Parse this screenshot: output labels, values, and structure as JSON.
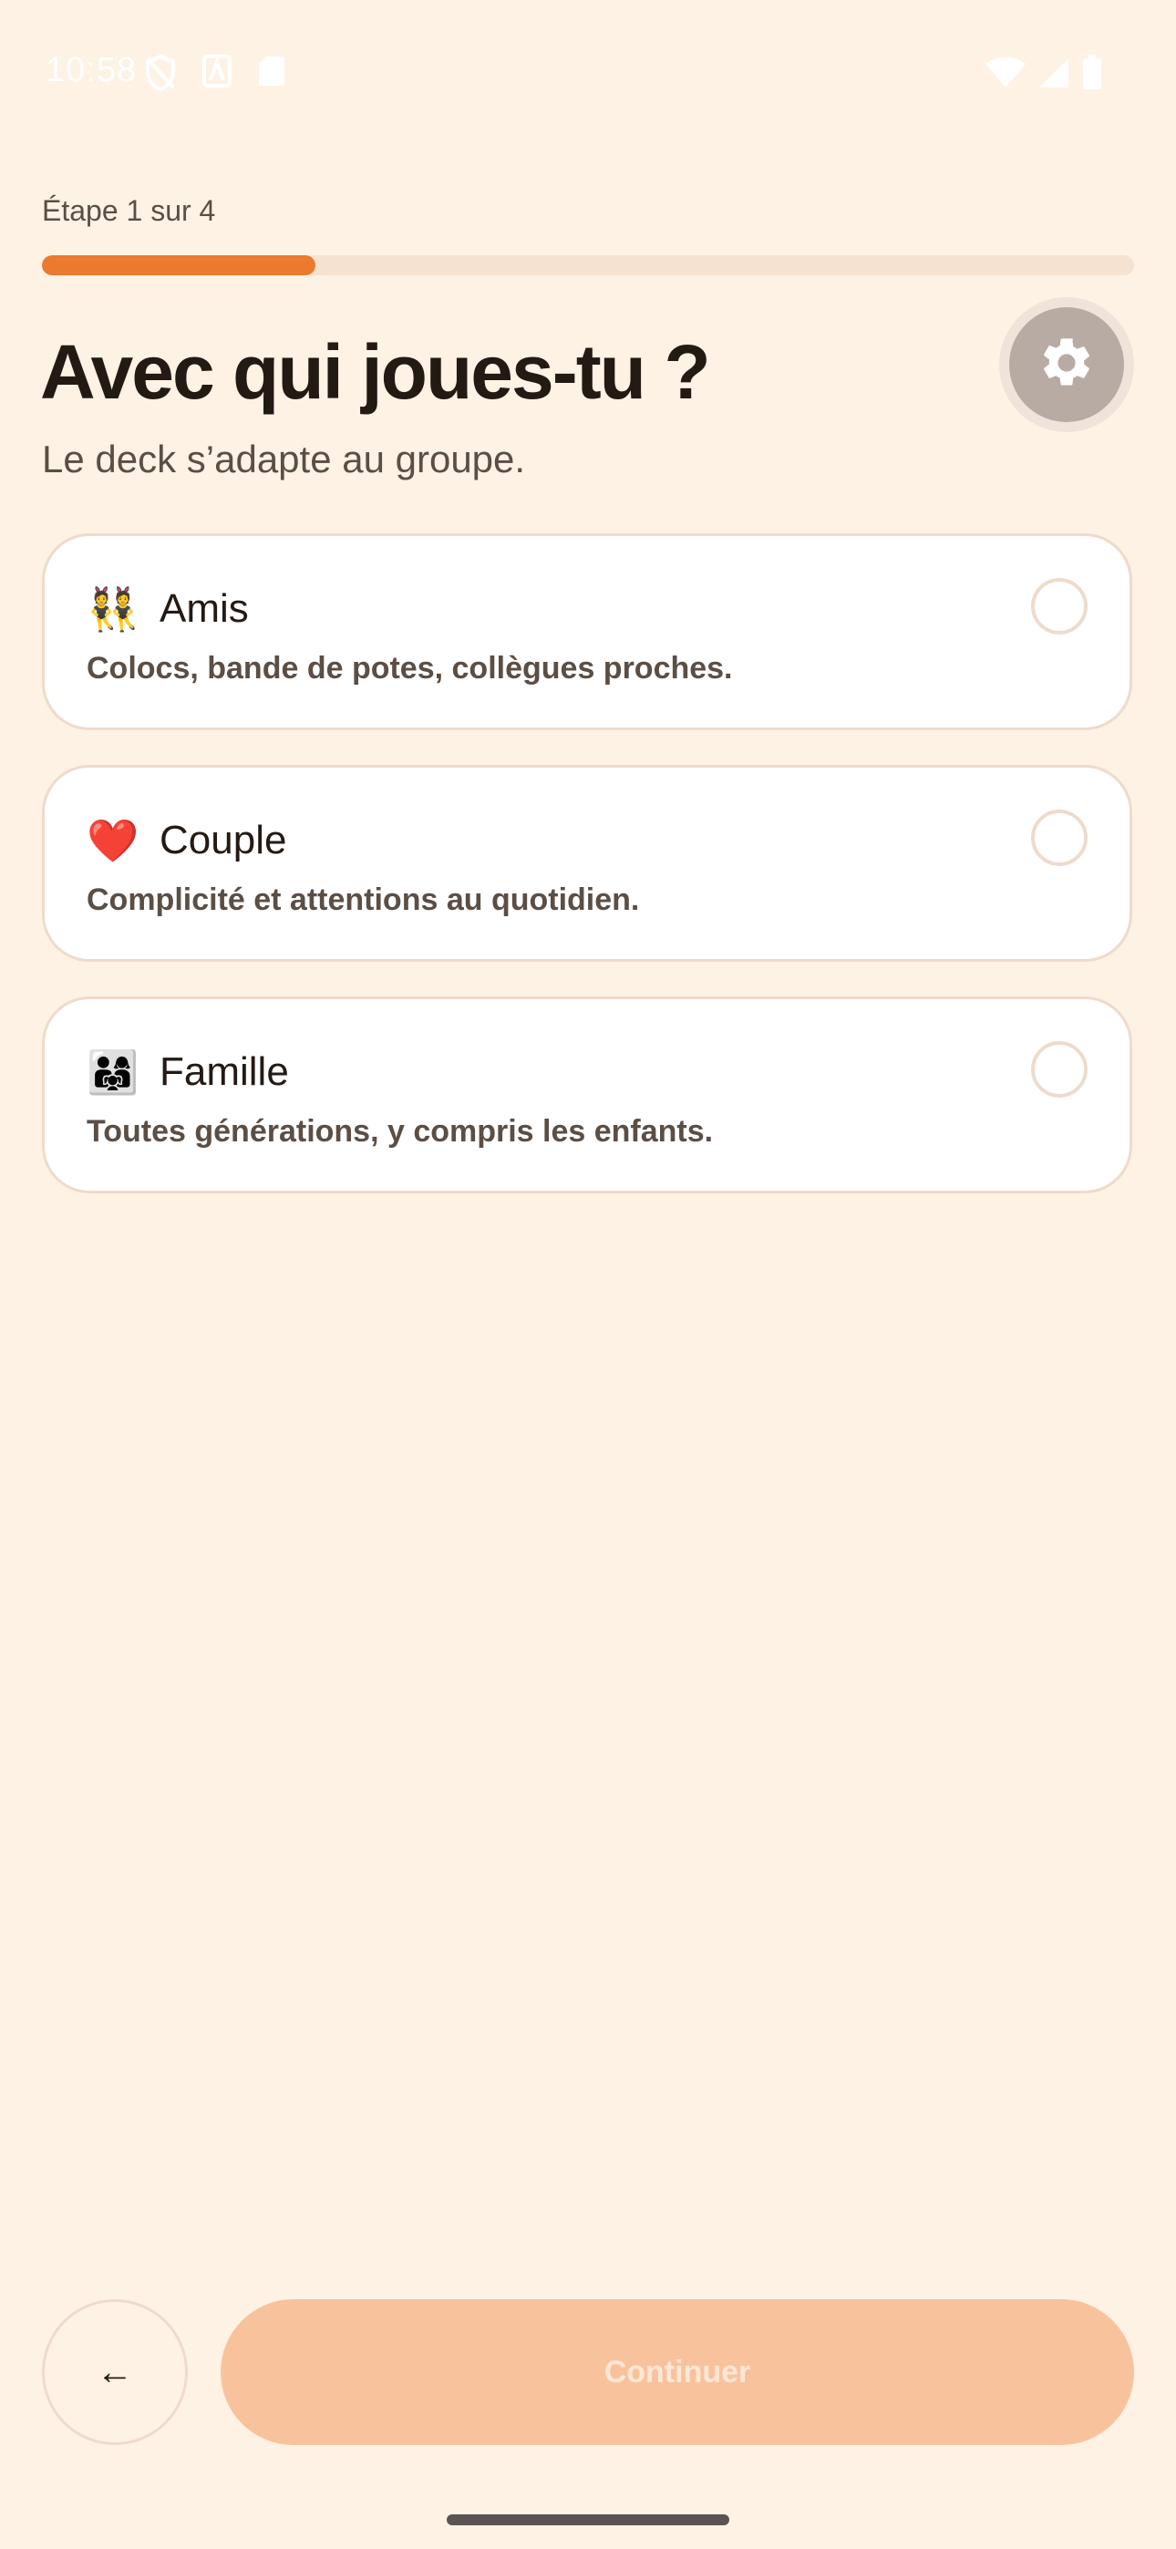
{
  "status_bar": {
    "time": "10:58",
    "left_icons": [
      "vpn-off-icon",
      "notification-a-icon",
      "sd-card-icon"
    ],
    "right_icons": [
      "wifi-icon",
      "signal-icon",
      "battery-icon"
    ]
  },
  "onboarding": {
    "step_label": "Étape 1 sur 4",
    "progress": 0.25,
    "title": "Avec qui joues-tu ?",
    "subtitle": "Le deck s’adapte au groupe.",
    "settings_icon": "gear-icon"
  },
  "options": [
    {
      "emoji": "👯",
      "label": "Amis",
      "description": "Colocs, bande de potes, collègues proches.",
      "selected": false
    },
    {
      "emoji": "❤️",
      "label": "Couple",
      "description": "Complicité et attentions au quotidien.",
      "selected": false
    },
    {
      "emoji": "👨‍👩‍👧",
      "label": "Famille",
      "description": "Toutes générations, y compris les enfants.",
      "selected": false
    }
  ],
  "footer": {
    "back_label": "←",
    "continue_label": "Continuer"
  },
  "colors": {
    "background": "#FEF2E5",
    "accent": "#EB7A2E",
    "continue_disabled": "#F8C39C"
  }
}
